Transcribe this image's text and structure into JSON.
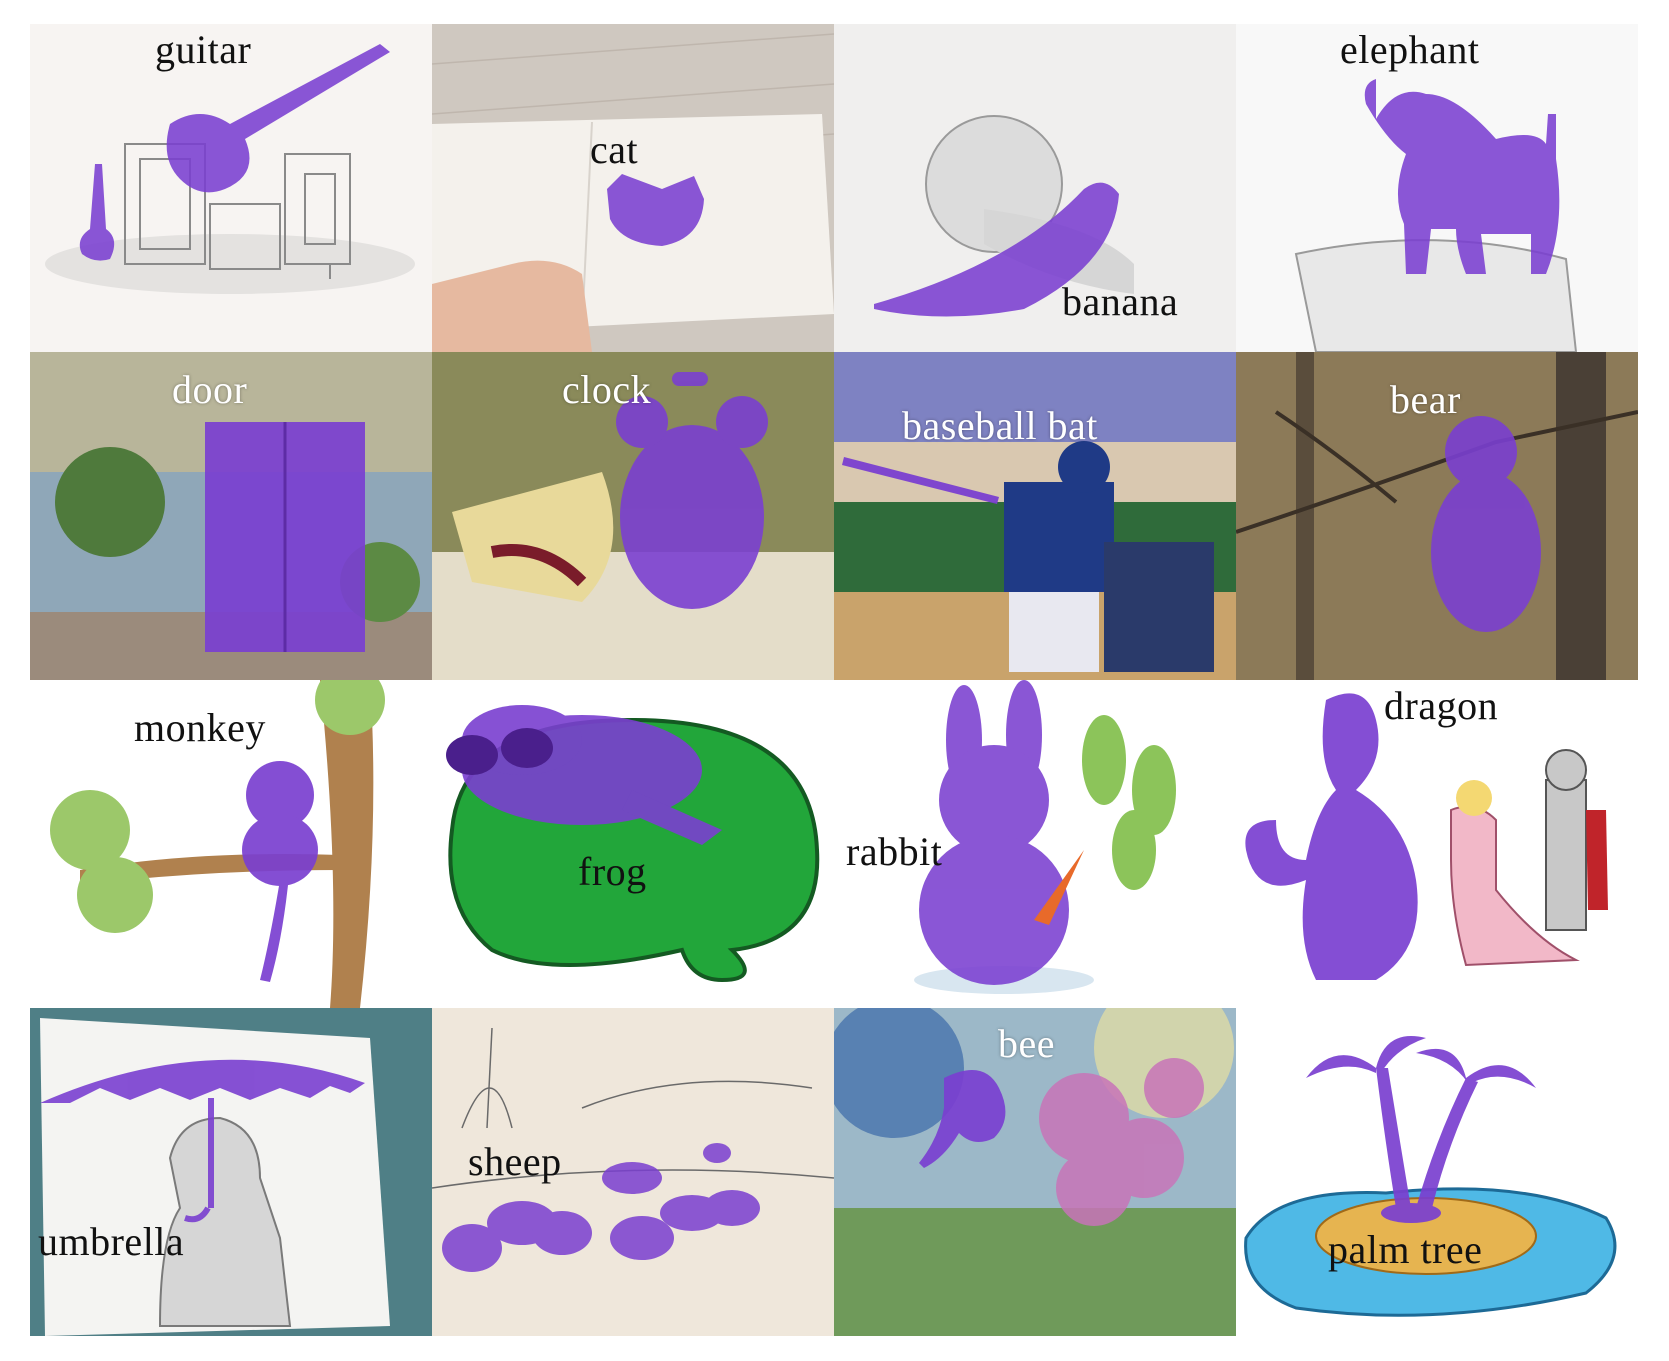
{
  "mask_color": "#7a3fd0",
  "tiles": [
    {
      "label": "guitar",
      "style": "sketch",
      "text_tone": "dark"
    },
    {
      "label": "cat",
      "style": "photo",
      "text_tone": "dark"
    },
    {
      "label": "banana",
      "style": "sketch",
      "text_tone": "dark"
    },
    {
      "label": "elephant",
      "style": "sketch",
      "text_tone": "dark"
    },
    {
      "label": "door",
      "style": "painting",
      "text_tone": "light"
    },
    {
      "label": "clock",
      "style": "painting",
      "text_tone": "light"
    },
    {
      "label": "baseball bat",
      "style": "painting",
      "text_tone": "light"
    },
    {
      "label": "bear",
      "style": "painting",
      "text_tone": "light"
    },
    {
      "label": "monkey",
      "style": "clipart",
      "text_tone": "dark"
    },
    {
      "label": "frog",
      "style": "clipart",
      "text_tone": "dark"
    },
    {
      "label": "rabbit",
      "style": "clipart",
      "text_tone": "dark"
    },
    {
      "label": "dragon",
      "style": "clipart",
      "text_tone": "dark"
    },
    {
      "label": "umbrella",
      "style": "sketch",
      "text_tone": "dark"
    },
    {
      "label": "sheep",
      "style": "sketch",
      "text_tone": "dark"
    },
    {
      "label": "bee",
      "style": "painting",
      "text_tone": "light"
    },
    {
      "label": "palm tree",
      "style": "clipart",
      "text_tone": "dark"
    }
  ]
}
